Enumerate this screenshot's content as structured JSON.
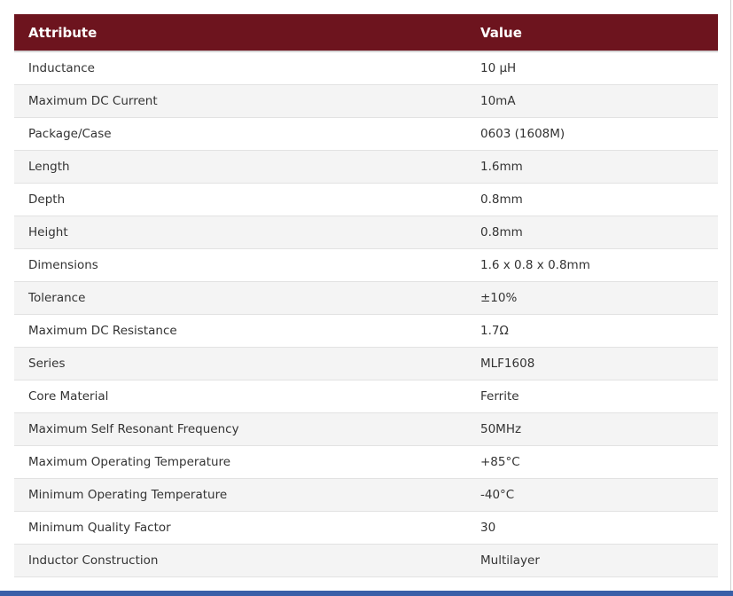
{
  "table": {
    "headers": [
      "Attribute",
      "Value"
    ],
    "rows": [
      [
        "Inductance",
        "10 µH"
      ],
      [
        "Maximum DC Current",
        "10mA"
      ],
      [
        "Package/Case",
        "0603 (1608M)"
      ],
      [
        "Length",
        "1.6mm"
      ],
      [
        "Depth",
        "0.8mm"
      ],
      [
        "Height",
        "0.8mm"
      ],
      [
        "Dimensions",
        "1.6 x 0.8 x 0.8mm"
      ],
      [
        "Tolerance",
        "±10%"
      ],
      [
        "Maximum DC Resistance",
        "1.7Ω"
      ],
      [
        "Series",
        "MLF1608"
      ],
      [
        "Core Material",
        "Ferrite"
      ],
      [
        "Maximum Self Resonant Frequency",
        "50MHz"
      ],
      [
        "Maximum Operating Temperature",
        "+85°C"
      ],
      [
        "Minimum Operating Temperature",
        "-40°C"
      ],
      [
        "Minimum Quality Factor",
        "30"
      ],
      [
        "Inductor Construction",
        "Multilayer"
      ]
    ]
  },
  "colors": {
    "header_bg": "#6d141e",
    "row_alt_bg": "#f4f4f4",
    "bottom_strip": "#3a5fa8"
  }
}
